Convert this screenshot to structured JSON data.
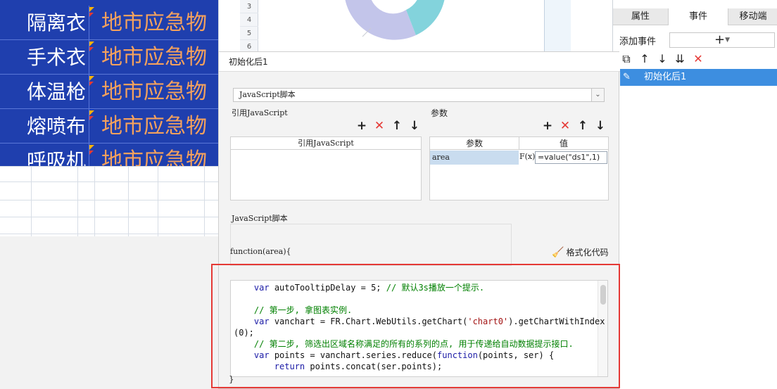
{
  "report_table": {
    "rows": [
      {
        "name": "隔离衣",
        "value": "地市应急物"
      },
      {
        "name": "手术衣",
        "value": "地市应急物"
      },
      {
        "name": "体温枪",
        "value": "地市应急物"
      },
      {
        "name": "熔喷布",
        "value": "地市应急物"
      },
      {
        "name": "呼吸机",
        "value": "地市应急物"
      }
    ],
    "row_numbers": [
      "3",
      "4",
      "5",
      "6"
    ]
  },
  "right_panel": {
    "tabs": [
      "属性",
      "事件",
      "移动端"
    ],
    "active_tab": "事件",
    "add_event_label": "添加事件",
    "add_event_value": "+",
    "toolbar_icons": [
      "copy-icon",
      "arrow-up-icon",
      "arrow-down-icon",
      "sort-icon",
      "delete-icon"
    ],
    "events": [
      {
        "label": "初始化后1"
      }
    ]
  },
  "dialog": {
    "title": "初始化后1",
    "script_type": "JavaScript脚本",
    "ref_js_label": "引用JavaScript",
    "ref_js_column": "引用JavaScript",
    "params_label": "参数",
    "param_columns": [
      "参数",
      "值"
    ],
    "params": [
      {
        "name": "area",
        "fx": "F(x)",
        "value": "=value(\"ds1\",1)"
      }
    ],
    "script_label": "JavaScript脚本",
    "function_open": "function(area){",
    "format_code_label": "格式化代码",
    "function_close": "}",
    "code_lines": [
      "    var autoTooltipDelay = 5; // 默认3s播放一个提示.",
      "",
      "    // 第一步, 拿图表实例.",
      "    var vanchart = FR.Chart.WebUtils.getChart('chart0').getChartWithIndex",
      "(0);",
      "    // 第二步, 筛选出区域名称满足的所有的系列的点, 用于传递给自动数据提示接口.",
      "    var points = vanchart.series.reduce(function(points, ser) {",
      "        return points.concat(ser.points);"
    ]
  },
  "colors": {
    "report_bg": "#1f3fae",
    "report_value": "#f4a15d",
    "selection": "#3d8ee0",
    "highlight_box": "#e53935"
  }
}
